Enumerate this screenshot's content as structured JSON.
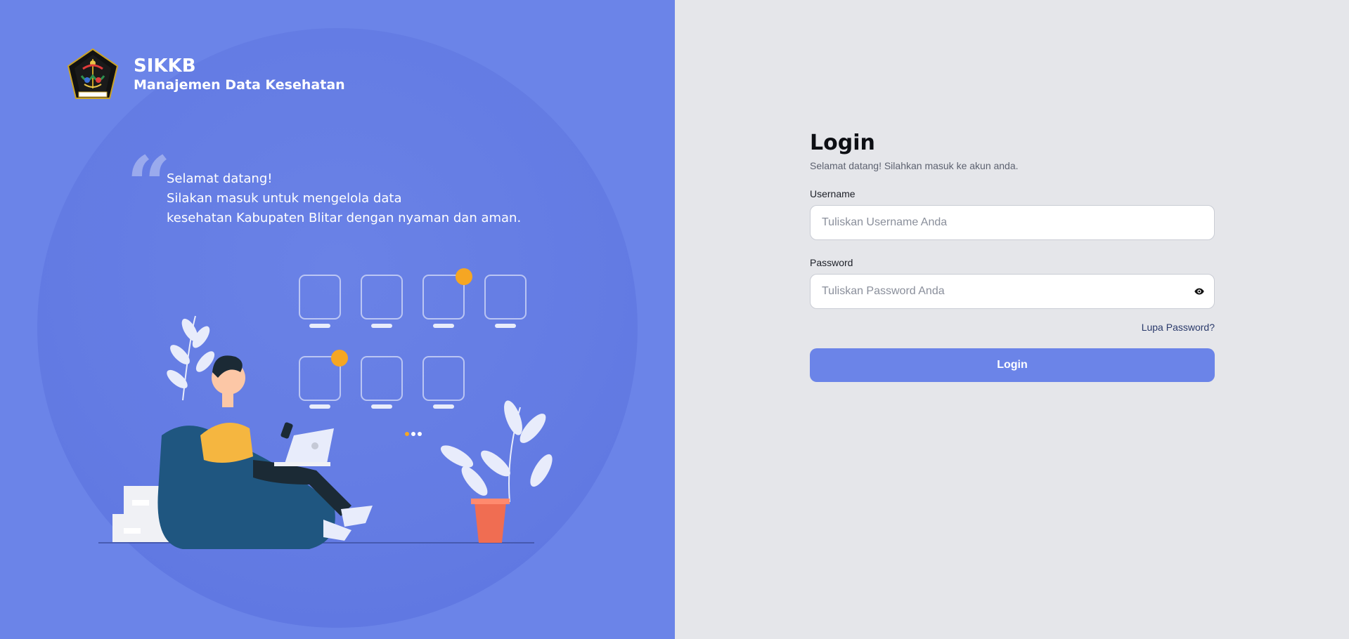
{
  "brand": {
    "title": "SIKKB",
    "subtitle": "Manajemen Data Kesehatan",
    "logo_icon": "regency-emblem-icon"
  },
  "quote": {
    "mark": "“",
    "lines": [
      "Selamat datang!",
      "Silakan masuk untuk mengelola data",
      "kesehatan Kabupaten Blitar dengan nyaman dan aman."
    ]
  },
  "login": {
    "title": "Login",
    "subtitle": "Selamat datang! Silahkan masuk ke akun anda.",
    "username_label": "Username",
    "username_placeholder": "Tuliskan Username Anda",
    "username_value": "",
    "password_label": "Password",
    "password_placeholder": "Tuliskan Password Anda",
    "password_value": "",
    "toggle_icon": "eye-icon",
    "forgot_label": "Lupa Password?",
    "submit_label": "Login"
  },
  "colors": {
    "left_panel": "#6b84e8",
    "right_panel": "#e5e6ea",
    "accent": "#6b84e8",
    "badge": "#f5a623"
  }
}
